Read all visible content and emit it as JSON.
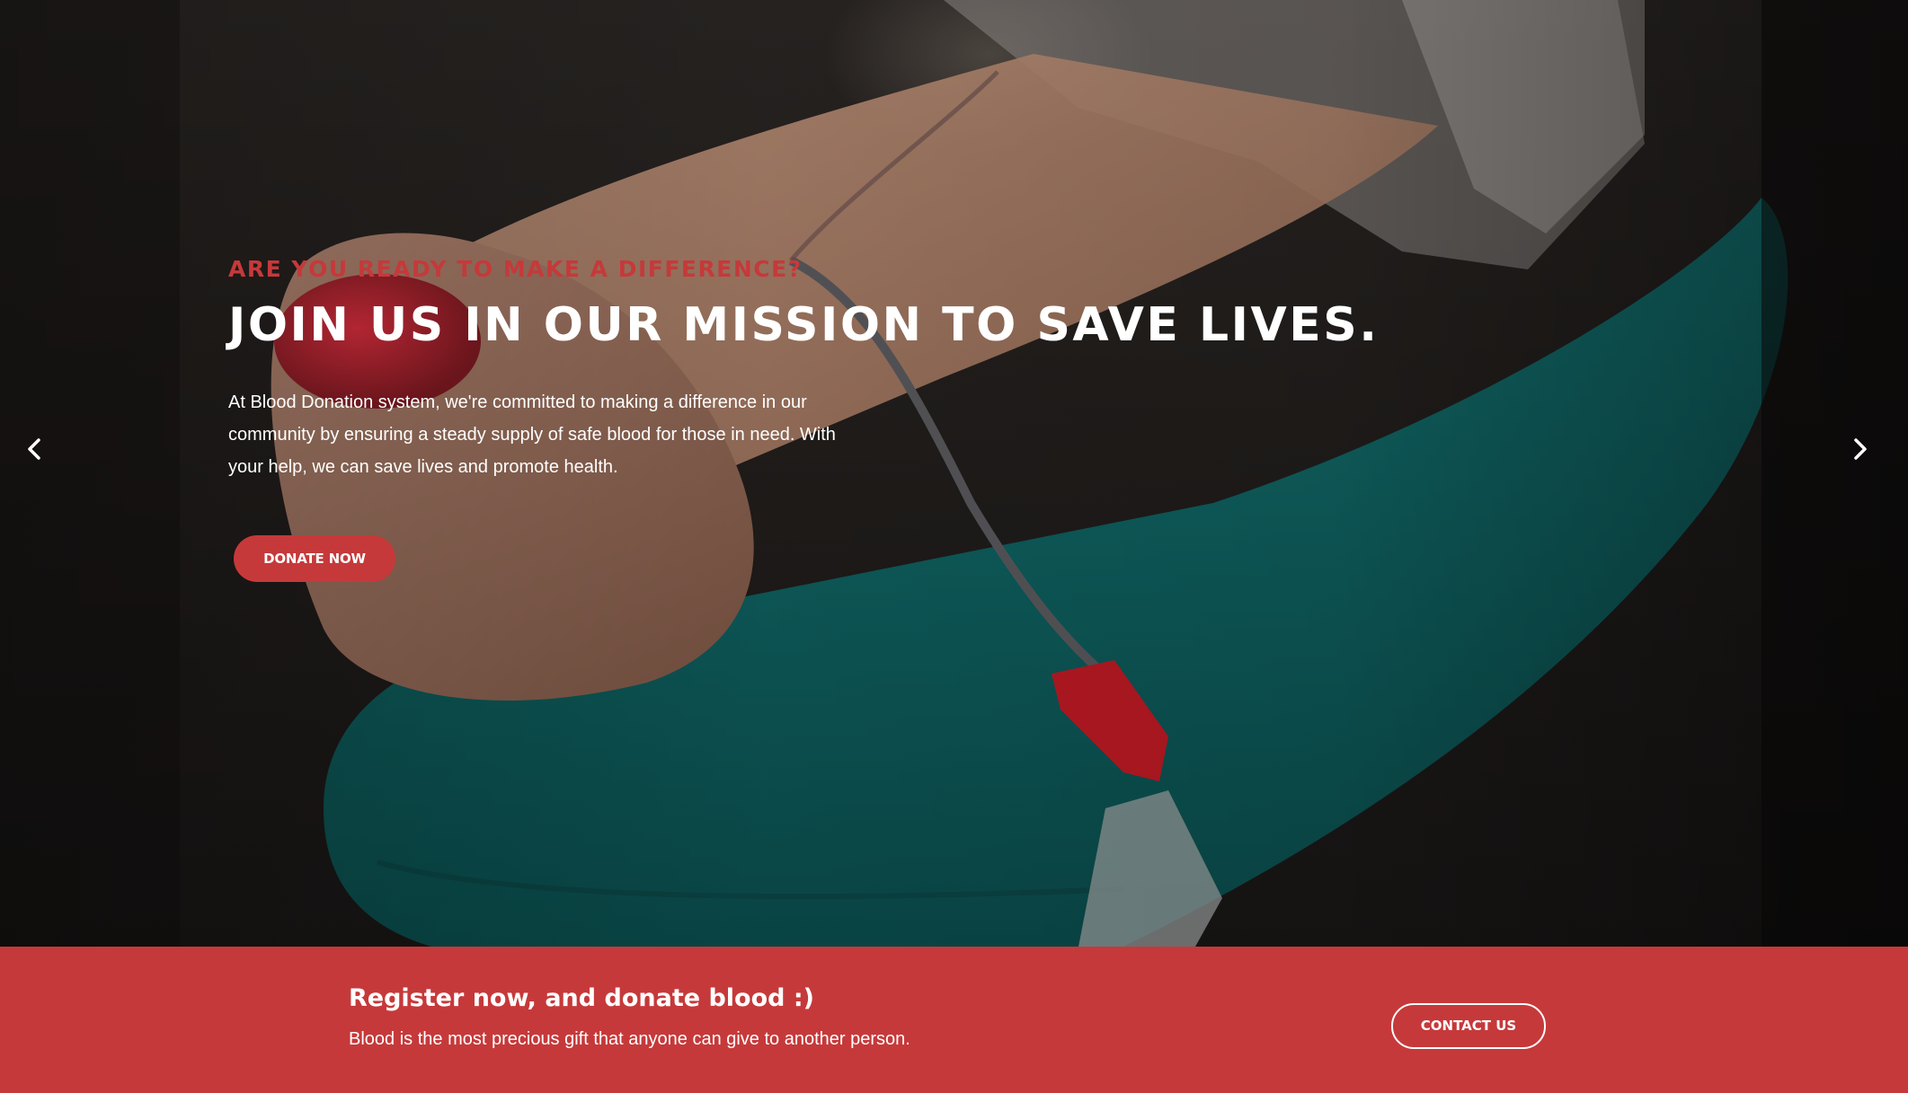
{
  "hero": {
    "eyebrow": "ARE YOU READY TO MAKE A DIFFERENCE?",
    "headline": "JOIN US IN OUR MISSION TO SAVE LIVES.",
    "description": "At Blood Donation system, we're committed to making a difference in our community by ensuring a steady supply of safe blood for those in need. With your help, we can save lives and promote health.",
    "donate_label": "DONATE NOW",
    "prev_icon": "chevron-left-icon",
    "next_icon": "chevron-right-icon"
  },
  "cta": {
    "title": "Register now, and donate blood :)",
    "subtitle": "Blood is the most precious gift that anyone can give to another person.",
    "contact_label": "CONTACT US"
  },
  "colors": {
    "accent": "#c6393a",
    "text_light": "#ffffff",
    "hero_teal": "#0f5c5c"
  }
}
